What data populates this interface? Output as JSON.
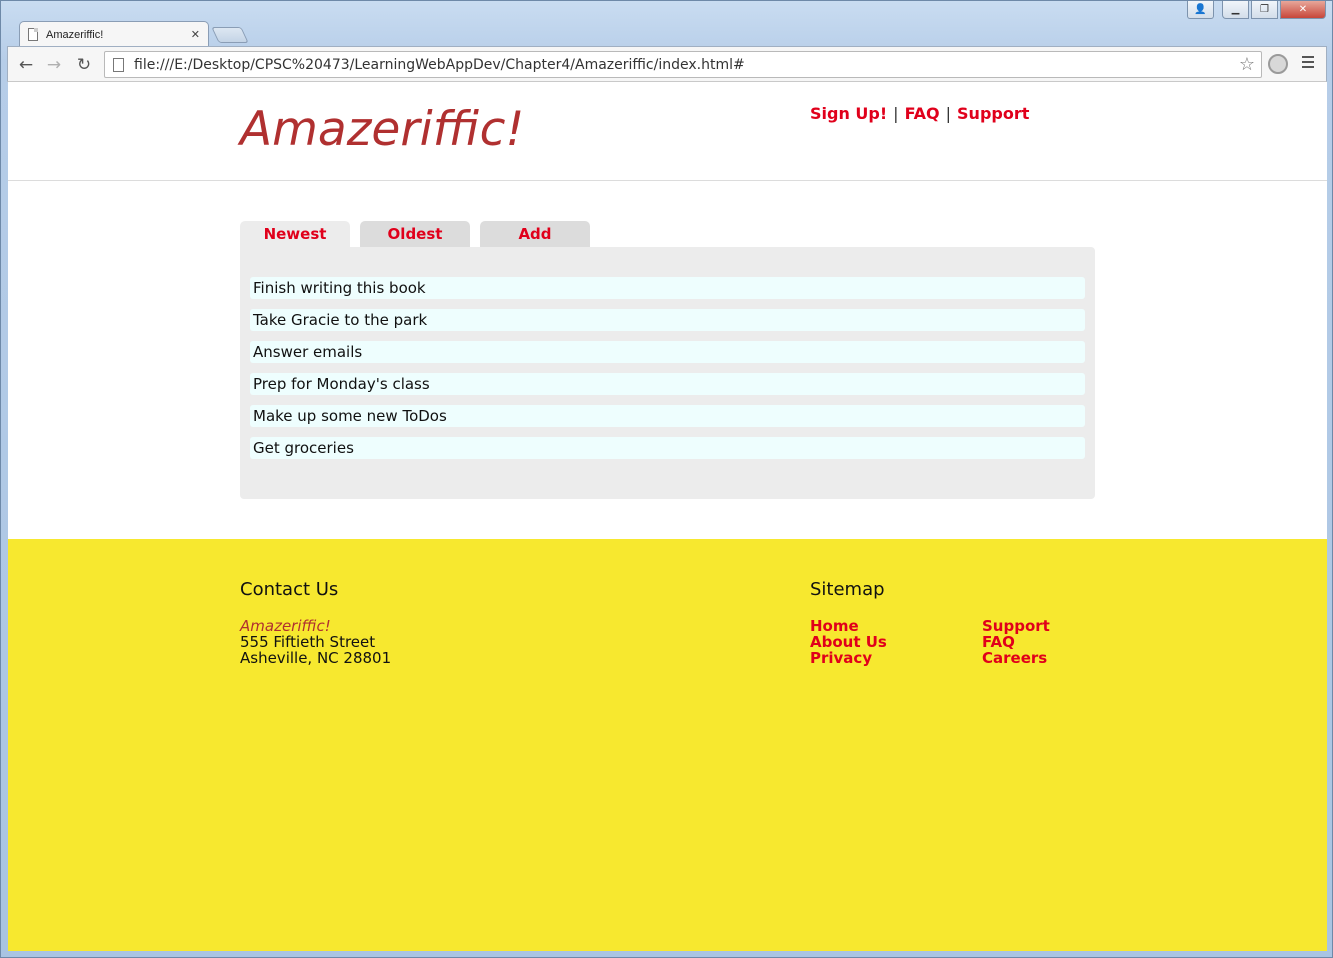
{
  "browser": {
    "tab_title": "Amazeriffic!",
    "tab_close": "✕",
    "url": "file:///E:/Desktop/CPSC%20473/LearningWebAppDev/Chapter4/Amazeriffic/index.html#",
    "back_glyph": "←",
    "forward_glyph": "→",
    "reload_glyph": "↻",
    "star_glyph": "☆",
    "minimize_glyph": "▁",
    "maximize_glyph": "❐",
    "close_glyph": "✕",
    "user_glyph": "👤"
  },
  "header": {
    "logo": "Amazeriffic!",
    "nav": {
      "signup": "Sign Up!",
      "faq": "FAQ",
      "support": "Support",
      "separator": "|"
    }
  },
  "tabs": [
    {
      "label": "Newest",
      "active": true
    },
    {
      "label": "Oldest",
      "active": false
    },
    {
      "label": "Add",
      "active": false
    }
  ],
  "todos": [
    "Finish writing this book",
    "Take Gracie to the park",
    "Answer emails",
    "Prep for Monday's class",
    "Make up some new ToDos",
    "Get groceries"
  ],
  "footer": {
    "contact": {
      "heading": "Contact Us",
      "brand": "Amazeriffic!",
      "street": "555 Fiftieth Street",
      "city": "Asheville, NC 28801"
    },
    "sitemap": {
      "heading": "Sitemap",
      "col1": [
        "Home",
        "About Us",
        "Privacy"
      ],
      "col2": [
        "Support",
        "FAQ",
        "Careers"
      ]
    }
  },
  "colors": {
    "logo": "#b03030",
    "link": "#e0001b",
    "footer_bg": "#f7e82f",
    "todo_bg": "#eefefe",
    "panel_bg": "#ececec"
  }
}
